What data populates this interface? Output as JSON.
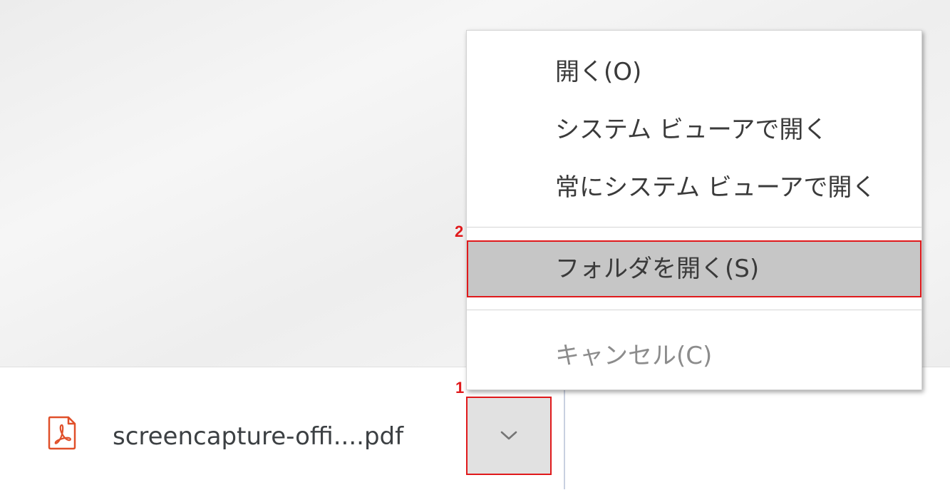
{
  "download_shelf": {
    "file_name": "screencapture-offi....pdf",
    "file_icon": "pdf-file-icon",
    "menu_toggle_icon": "chevron-down-icon"
  },
  "context_menu": {
    "items": [
      {
        "label": "開く(O)",
        "enabled": true
      },
      {
        "label": "システム ビューアで開く",
        "enabled": true
      },
      {
        "label": "常にシステム ビューアで開く",
        "enabled": true
      },
      {
        "label": "フォルダを開く(S)",
        "enabled": true,
        "highlighted": true
      },
      {
        "label": "キャンセル(C)",
        "enabled": false
      }
    ]
  },
  "annotations": {
    "step_1": "1",
    "step_2": "2"
  },
  "colors": {
    "highlight_border": "#e0191b",
    "pdf_icon": "#e0502a",
    "highlighted_item_bg": "#c6c6c6"
  }
}
